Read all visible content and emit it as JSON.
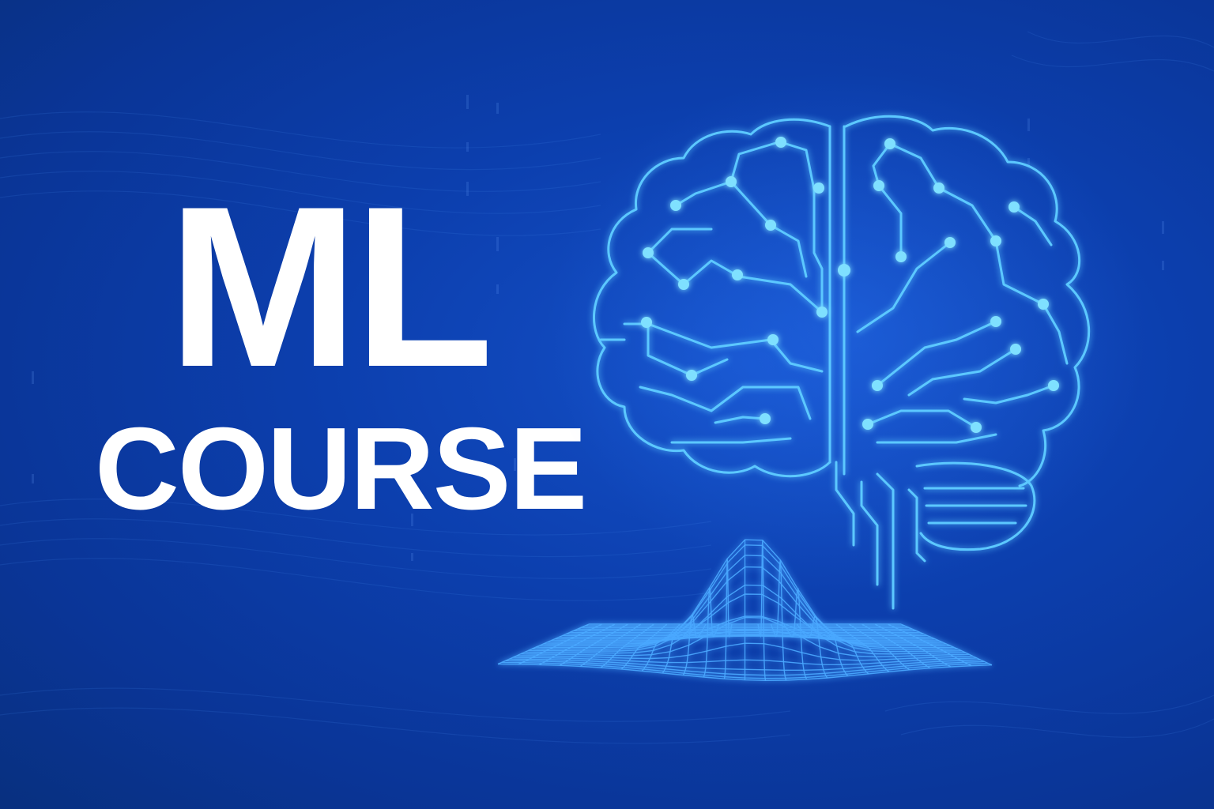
{
  "title": {
    "line1": "ML",
    "line2": "COURSE"
  },
  "colors": {
    "background": "#0c3fae",
    "text": "#ffffff",
    "circuit": "#5cc8ff",
    "node": "#7fe0ff",
    "mesh": "#4aa8ff"
  },
  "icons": {
    "brain": "brain-circuit-icon",
    "surface": "gaussian-surface-mesh"
  }
}
